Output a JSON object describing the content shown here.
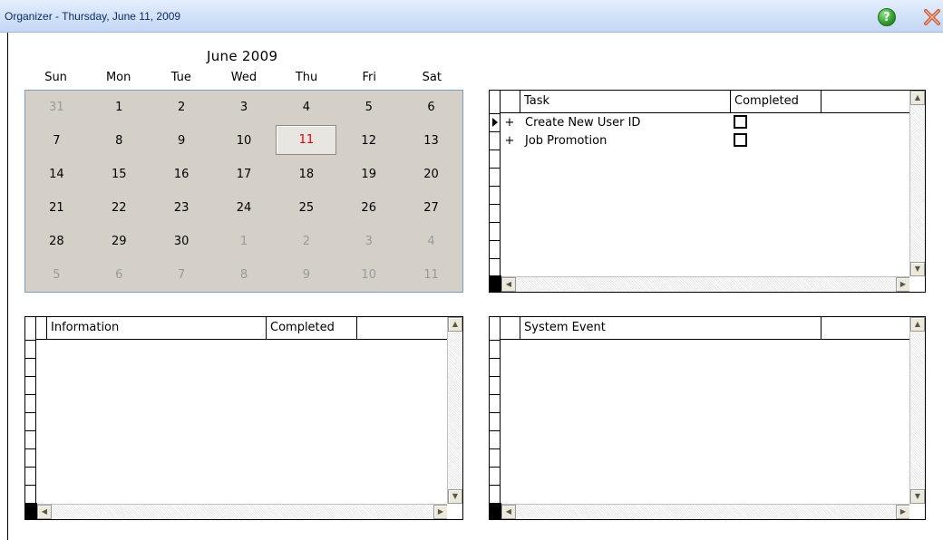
{
  "window": {
    "title": "Organizer - Thursday, June 11, 2009"
  },
  "calendar": {
    "month_label": "June 2009",
    "days_of_week": [
      "Sun",
      "Mon",
      "Tue",
      "Wed",
      "Thu",
      "Fri",
      "Sat"
    ],
    "weeks": [
      [
        {
          "d": "31",
          "other": true
        },
        {
          "d": "1"
        },
        {
          "d": "2"
        },
        {
          "d": "3"
        },
        {
          "d": "4"
        },
        {
          "d": "5"
        },
        {
          "d": "6"
        }
      ],
      [
        {
          "d": "7"
        },
        {
          "d": "8"
        },
        {
          "d": "9"
        },
        {
          "d": "10"
        },
        {
          "d": "11",
          "selected": true
        },
        {
          "d": "12"
        },
        {
          "d": "13"
        }
      ],
      [
        {
          "d": "14"
        },
        {
          "d": "15"
        },
        {
          "d": "16"
        },
        {
          "d": "17"
        },
        {
          "d": "18"
        },
        {
          "d": "19"
        },
        {
          "d": "20"
        }
      ],
      [
        {
          "d": "21"
        },
        {
          "d": "22"
        },
        {
          "d": "23"
        },
        {
          "d": "24"
        },
        {
          "d": "25"
        },
        {
          "d": "26"
        },
        {
          "d": "27"
        }
      ],
      [
        {
          "d": "28"
        },
        {
          "d": "29"
        },
        {
          "d": "30"
        },
        {
          "d": "1",
          "other": true
        },
        {
          "d": "2",
          "other": true
        },
        {
          "d": "3",
          "other": true
        },
        {
          "d": "4",
          "other": true
        }
      ],
      [
        {
          "d": "5",
          "other": true
        },
        {
          "d": "6",
          "other": true
        },
        {
          "d": "7",
          "other": true
        },
        {
          "d": "8",
          "other": true
        },
        {
          "d": "9",
          "other": true
        },
        {
          "d": "10",
          "other": true
        },
        {
          "d": "11",
          "other": true
        }
      ]
    ],
    "selected_color": "#e00000"
  },
  "task_grid": {
    "columns": [
      "Task",
      "Completed"
    ],
    "rows": [
      {
        "expander": "+",
        "name": "Create New User ID",
        "completed": false
      },
      {
        "expander": "+",
        "name": "Job Promotion",
        "completed": false
      }
    ]
  },
  "info_grid": {
    "columns": [
      "Information",
      "Completed"
    ]
  },
  "event_grid": {
    "columns": [
      "System Event"
    ]
  },
  "icons": {
    "help": "help-icon",
    "close": "close-icon"
  },
  "help_glyph": "?"
}
